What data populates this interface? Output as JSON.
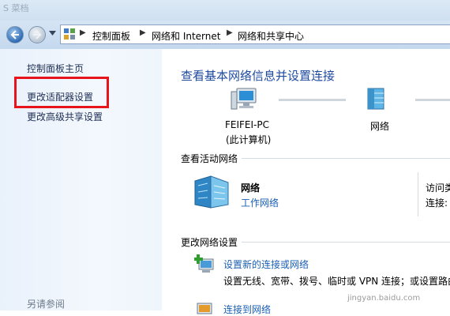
{
  "window": {
    "title_fragment": "S 菜档"
  },
  "address_bar": {
    "crumbs": [
      "控制面板",
      "网络和 Internet",
      "网络和共享中心"
    ]
  },
  "sidebar": {
    "home": "控制面板主页",
    "items": [
      {
        "label": "更改适配器设置",
        "highlighted": true
      },
      {
        "label": "更改高级共享设置"
      }
    ],
    "see_also": "另请参阅"
  },
  "main": {
    "title": "查看基本网络信息并设置连接",
    "network_map": {
      "computer_name": "FEIFEI-PC",
      "computer_sub": "(此计算机)",
      "network_label": "网络"
    },
    "active_networks": {
      "title": "查看活动网络",
      "network_name": "网络",
      "network_type": "工作网络",
      "access_label": "访问类",
      "connections_label": "连接:"
    },
    "change_settings": {
      "title": "更改网络设置",
      "tasks": [
        {
          "link": "设置新的连接或网络",
          "desc": "设置无线、宽带、拨号、临时或 VPN 连接；或设置路由"
        },
        {
          "link": "连接到网络"
        }
      ]
    }
  },
  "watermark": "jingyan.baidu.com",
  "colors": {
    "accent_link": "#1a5fb4",
    "title_blue": "#1e4aa0",
    "highlight_red": "#e8141c"
  },
  "icons": [
    "back-icon",
    "forward-icon",
    "dropdown-icon",
    "control-panel-icon",
    "computer-icon",
    "network-icon",
    "network-building-icon",
    "new-connection-icon",
    "connect-network-icon"
  ]
}
